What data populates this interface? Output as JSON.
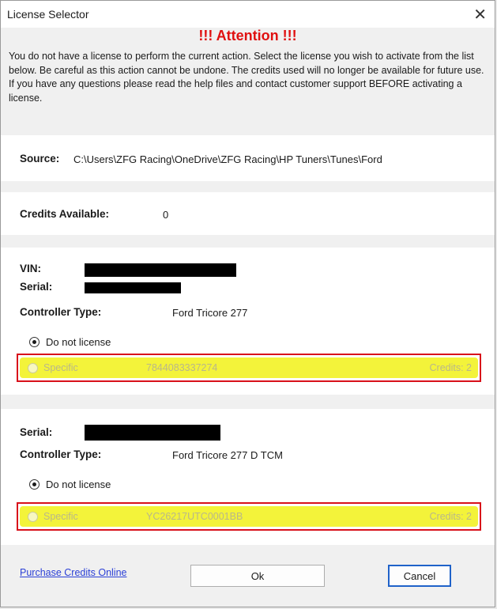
{
  "window": {
    "title": "License Selector"
  },
  "attention": "!!!  Attention  !!!",
  "warning_text": "You do not have a license to perform the current action. Select the license you wish to activate from the list below. Be careful as this action cannot be undone. The credits used will no longer be available for future use. If you have any questions please read the help files and contact customer support BEFORE activating a license.",
  "source": {
    "label": "Source:",
    "value": "C:\\Users\\ZFG Racing\\OneDrive\\ZFG Racing\\HP Tuners\\Tunes\\Ford"
  },
  "credits": {
    "label": "Credits Available:",
    "value": "0"
  },
  "controllers": [
    {
      "vin_label": "VIN:",
      "serial_label": "Serial:",
      "type_label": "Controller Type:",
      "type_value": "Ford Tricore 277",
      "do_not_license": "Do not license",
      "specific_label": "Specific",
      "specific_id": "7844083337274",
      "specific_credits": "Credits: 2"
    },
    {
      "serial_label": "Serial:",
      "type_label": "Controller Type:",
      "type_value": "Ford Tricore 277 D TCM",
      "do_not_license": "Do not license",
      "specific_label": "Specific",
      "specific_id": "YC26217UTC0001BB",
      "specific_credits": "Credits: 2"
    }
  ],
  "footer": {
    "purchase_link": "Purchase Credits Online",
    "ok_label": "Ok",
    "cancel_label": "Cancel"
  }
}
